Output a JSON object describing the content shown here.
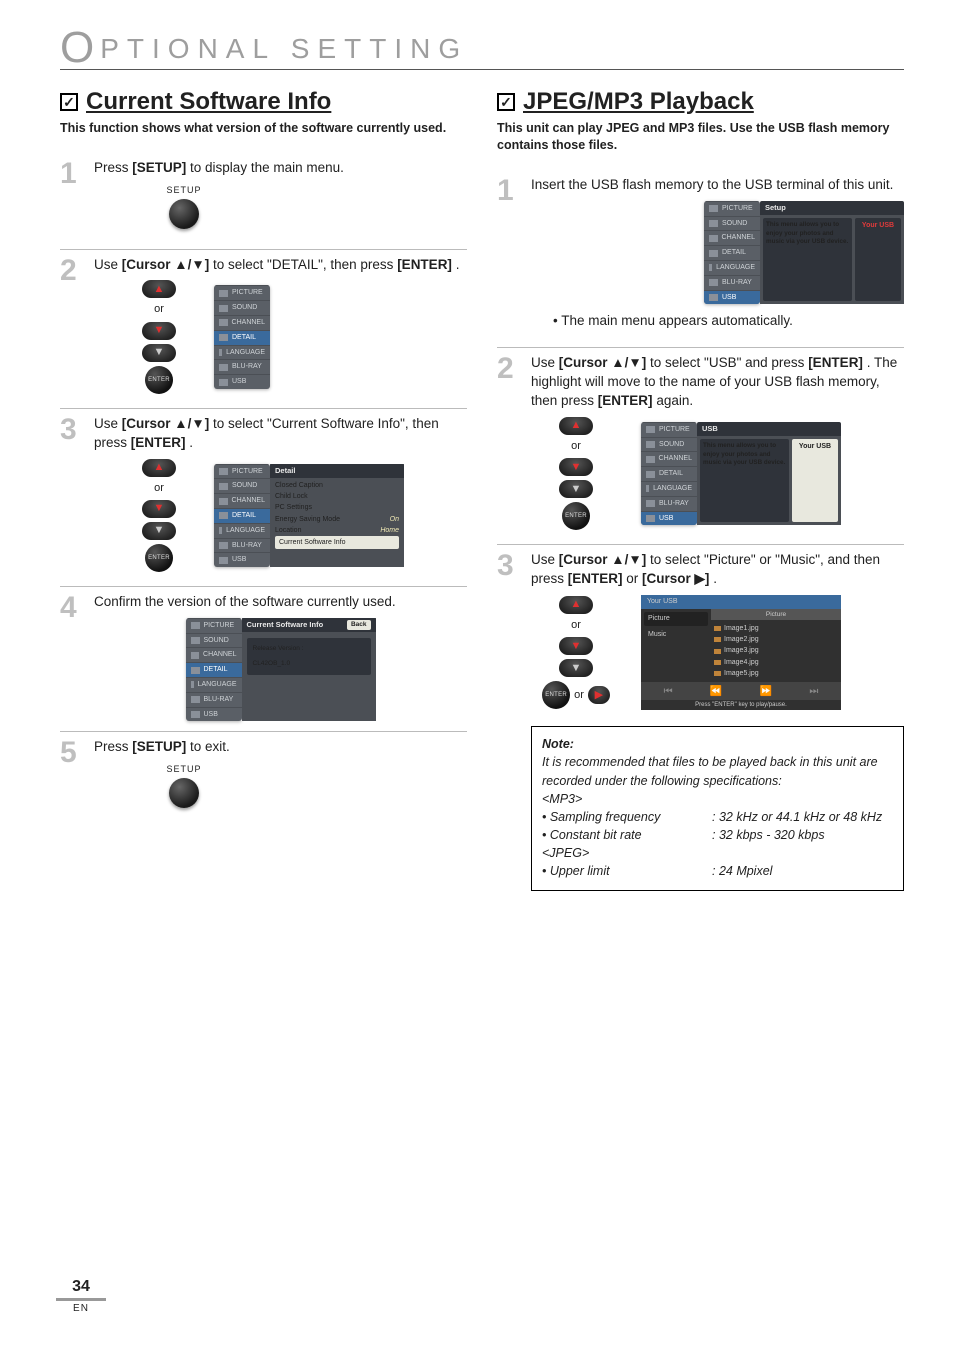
{
  "page": {
    "title_prefix": "O",
    "title_rest": "PTIONAL  SETTING",
    "number": "34",
    "lang": "EN"
  },
  "osd_labels": {
    "picture": "PICTURE",
    "sound": "SOUND",
    "channel": "CHANNEL",
    "detail": "DETAIL",
    "language": "LANGUAGE",
    "bluray": "BLU-RAY",
    "usb": "USB"
  },
  "left": {
    "title": "Current Software Info",
    "subtitle": "This function shows what version of the software currently used.",
    "step1": {
      "text_a": "Press ",
      "text_b": "[SETUP]",
      "text_c": " to display the main menu.",
      "btn": "SETUP"
    },
    "step2": {
      "text_a": "Use ",
      "text_b": "[Cursor ▲/▼]",
      "text_c": " to select \"DETAIL\", then press ",
      "text_d": "[ENTER]",
      "text_e": ".",
      "or": "or",
      "enter": "ENTER"
    },
    "step3": {
      "text_a": "Use ",
      "text_b": "[Cursor ▲/▼]",
      "text_c": " to select \"Current Software Info\", then press ",
      "text_d": "[ENTER]",
      "text_e": ".",
      "or": "or",
      "enter": "ENTER",
      "panel_title": "Detail",
      "items": [
        "Closed Caption",
        "Child Lock",
        "PC Settings"
      ],
      "kv": [
        {
          "k": "Energy Saving Mode",
          "v": "On"
        },
        {
          "k": "Location",
          "v": "Home"
        }
      ],
      "hl": "Current Software Info"
    },
    "step4": {
      "text": "Confirm the version of the software currently used.",
      "panel_title": "Current Software Info",
      "back": "Back",
      "rv_label": "Release Version :",
      "rv_value": "CL42OB_1.0"
    },
    "step5": {
      "text_a": "Press ",
      "text_b": "[SETUP]",
      "text_c": " to exit.",
      "btn": "SETUP"
    }
  },
  "right": {
    "title": "JPEG/MP3 Playback",
    "subtitle": "This unit can play JPEG and MP3 files. Use the USB flash memory contains those files.",
    "step1": {
      "text": "Insert the USB flash memory to the USB terminal of this unit.",
      "panel_title": "Setup",
      "msg": "This menu allows you to enjoy your photos and music via your USB device.",
      "right_label": "Your USB",
      "bullet": "The main menu appears automatically."
    },
    "step2": {
      "text_a": "Use ",
      "text_b": "[Cursor ▲/▼]",
      "text_c": " to select \"USB\" and press ",
      "text_d": "[ENTER]",
      "text_e": ". The highlight will move to the name of your USB flash memory, then press ",
      "text_f": "[ENTER]",
      "text_g": " again.",
      "or": "or",
      "enter": "ENTER",
      "panel_title": "USB",
      "msg": "This menu allows you to enjoy your photos and music via your USB device.",
      "right_label": "Your USB"
    },
    "step3": {
      "text_a": "Use ",
      "text_b": "[Cursor ▲/▼]",
      "text_c": " to select \"Picture\" or \"Music\", and then press ",
      "text_d": "[ENTER]",
      "text_e": " or ",
      "text_f": "[Cursor ▶]",
      "text_g": ".",
      "or": "or",
      "enter": "ENTER",
      "fb_head": "Your USB",
      "fb_left": [
        "Picture",
        "Music"
      ],
      "fb_rhead": "Picture",
      "files": [
        "Image1.jpg",
        "Image2.jpg",
        "Image3.jpg",
        "Image4.jpg",
        "Image5.jpg"
      ],
      "hint": "Press \"ENTER\" key to play/pause."
    },
    "note": {
      "heading": "Note:",
      "lead": "It is recommended that files to be played back in this unit are recorded under the following specifications:",
      "mp3": "<MP3>",
      "spec1_l": "• Sampling frequency",
      "spec1_r": ": 32 kHz or 44.1 kHz or 48 kHz",
      "spec2_l": "• Constant bit rate",
      "spec2_r": ": 32 kbps - 320 kbps",
      "jpeg": "<JPEG>",
      "spec3_l": "• Upper limit",
      "spec3_r": ": 24 Mpixel"
    }
  }
}
